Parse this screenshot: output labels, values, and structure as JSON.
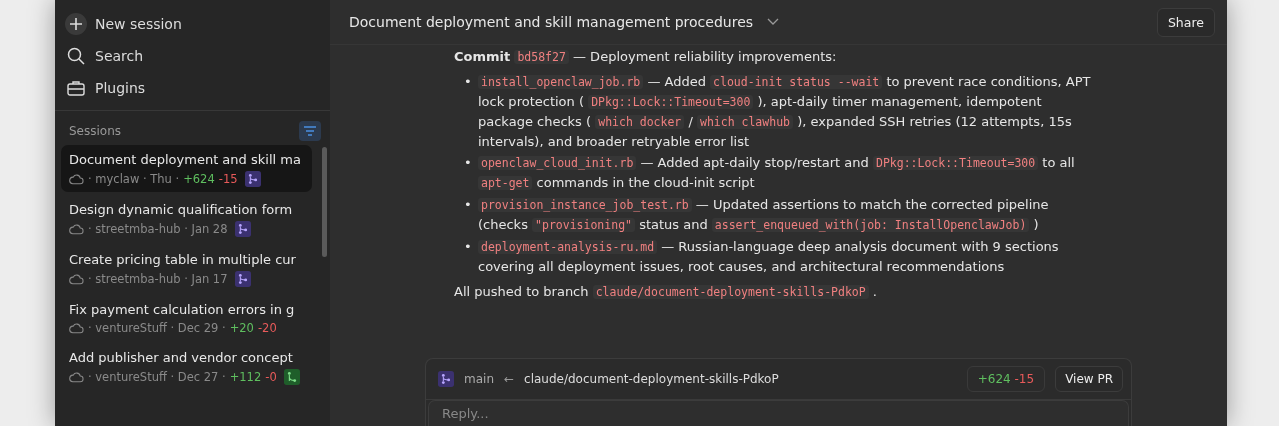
{
  "sidebar": {
    "actions": [
      {
        "kind": "new",
        "label": "New session"
      },
      {
        "kind": "search",
        "label": "Search"
      },
      {
        "kind": "plugins",
        "label": "Plugins"
      }
    ],
    "sessions_heading": "Sessions",
    "sessions": [
      {
        "title": "Document deployment and skill ma",
        "meta": "· myclaw · Thu ·",
        "added": "+624",
        "removed": "-15",
        "kind": "pr",
        "selected": true
      },
      {
        "title": "Design dynamic qualification form",
        "meta": "· streetmba-hub · Jan 28",
        "kind": "pr",
        "selected": false
      },
      {
        "title": "Create pricing table in multiple cur",
        "meta": "· streetmba-hub · Jan 17",
        "kind": "pr",
        "selected": false
      },
      {
        "title": "Fix payment calculation errors in g",
        "meta": "· ventureStuff · Dec 29 ·",
        "added": "+20",
        "removed": "-20",
        "kind": "plain",
        "selected": false
      },
      {
        "title": "Add publisher and vendor concept",
        "meta": "· ventureStuff · Dec 27 ·",
        "added": "+112",
        "removed": "-0",
        "kind": "merged",
        "selected": false
      }
    ]
  },
  "header": {
    "title": "Document deployment and skill management procedures",
    "share": "Share"
  },
  "message": {
    "intro": [
      {
        "kind": "bold",
        "text": "Commit"
      },
      {
        "kind": "code",
        "text": "bd58f27"
      },
      {
        "kind": "text",
        "text": "— Deployment reliability improvements:"
      }
    ],
    "bullets": [
      {
        "bullet": "•",
        "parts": [
          {
            "kind": "code",
            "text": "install_openclaw_job.rb"
          },
          {
            "kind": "text",
            "text": "— Added"
          },
          {
            "kind": "code",
            "text": "cloud-init status --wait"
          },
          {
            "kind": "text",
            "text": "to prevent race conditions, APT lock protection ("
          },
          {
            "kind": "code",
            "text": "DPkg::Lock::Timeout=300"
          },
          {
            "kind": "text",
            "text": "), apt-daily timer management, idempotent package checks ("
          },
          {
            "kind": "code",
            "text": "which docker"
          },
          {
            "kind": "text",
            "text": "/"
          },
          {
            "kind": "code",
            "text": "which clawhub"
          },
          {
            "kind": "text",
            "text": "), expanded SSH retries (12 attempts, 15s intervals), and broader retryable error list"
          }
        ]
      },
      {
        "bullet": "•",
        "parts": [
          {
            "kind": "code",
            "text": "openclaw_cloud_init.rb"
          },
          {
            "kind": "text",
            "text": "— Added apt-daily stop/restart and"
          },
          {
            "kind": "code",
            "text": "DPkg::Lock::Timeout=300"
          },
          {
            "kind": "text",
            "text": "to all"
          },
          {
            "kind": "code",
            "text": "apt-get"
          },
          {
            "kind": "text",
            "text": "commands in the cloud-init script"
          }
        ]
      },
      {
        "bullet": "•",
        "parts": [
          {
            "kind": "code",
            "text": "provision_instance_job_test.rb"
          },
          {
            "kind": "text",
            "text": "— Updated assertions to match the corrected pipeline (checks"
          },
          {
            "kind": "code",
            "text": "\"provisioning\""
          },
          {
            "kind": "text",
            "text": "status and"
          },
          {
            "kind": "code",
            "text": "assert_enqueued_with(job: InstallOpenclawJob)"
          },
          {
            "kind": "text",
            "text": ")"
          }
        ]
      },
      {
        "bullet": "•",
        "parts": [
          {
            "kind": "code",
            "text": "deployment-analysis-ru.md"
          },
          {
            "kind": "text",
            "text": "— Russian-language deep analysis document with 9 sections covering all deployment issues, root causes, and architectural recommendations"
          }
        ]
      }
    ],
    "outro": [
      {
        "kind": "text",
        "text": "All pushed to branch"
      },
      {
        "kind": "code",
        "text": "claude/document-deployment-skills-PdkoP"
      },
      {
        "kind": "text",
        "text": "."
      }
    ]
  },
  "branch_bar": {
    "base": "main",
    "arrow": "←",
    "branch": "claude/document-deployment-skills-PdkoP",
    "added": "+624",
    "removed": "-15",
    "view_pr": "View PR"
  },
  "reply": {
    "placeholder": "Reply..."
  }
}
